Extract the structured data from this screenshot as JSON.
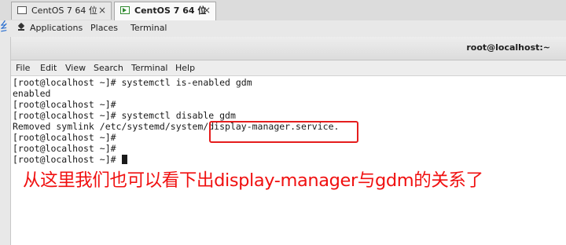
{
  "vm_tabs": [
    {
      "label": "CentOS 7 64 位",
      "active": false
    },
    {
      "label": "CentOS 7 64 位",
      "active": true
    }
  ],
  "tab_close_glyph": "×",
  "host_glyph": "纟",
  "gnome_bar": {
    "applications": "Applications",
    "places": "Places",
    "terminal": "Terminal"
  },
  "terminal": {
    "title": "root@localhost:~",
    "menu": [
      "File",
      "Edit",
      "View",
      "Search",
      "Terminal",
      "Help"
    ],
    "lines": [
      "[root@localhost ~]# systemctl is-enabled gdm",
      "enabled",
      "[root@localhost ~]#",
      "[root@localhost ~]# systemctl disable gdm",
      "Removed symlink /etc/systemd/system/display-manager.service.",
      "[root@localhost ~]#",
      "[root@localhost ~]#",
      "[root@localhost ~]# "
    ]
  },
  "annotation": {
    "caption": "从这里我们也可以看下出display-manager与gdm的关系了",
    "highlight_color": "#e51d1d",
    "text_color": "#f01010"
  }
}
